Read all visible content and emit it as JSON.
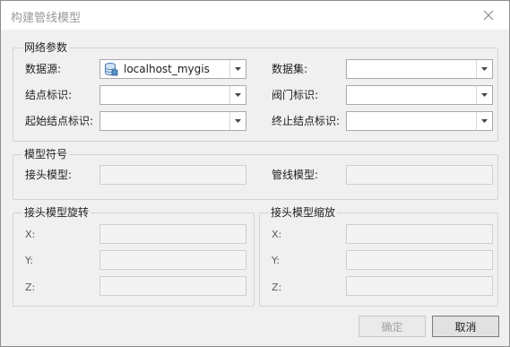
{
  "window": {
    "title": "构建管线模型"
  },
  "network_params": {
    "legend": "网络参数",
    "datasource_label": "数据源:",
    "datasource_value": "localhost_mygis",
    "dataset_label": "数据集:",
    "dataset_value": "",
    "node_id_label": "结点标识:",
    "node_id_value": "",
    "valve_id_label": "阀门标识:",
    "valve_id_value": "",
    "start_node_label": "起始结点标识:",
    "start_node_value": "",
    "end_node_label": "终止结点标识:",
    "end_node_value": ""
  },
  "model_symbol": {
    "legend": "模型符号",
    "joint_model_label": "接头模型:",
    "pipe_model_label": "管线模型:"
  },
  "joint_rotation": {
    "legend": "接头模型旋转",
    "x_label": "X:",
    "y_label": "Y:",
    "z_label": "Z:"
  },
  "joint_scale": {
    "legend": "接头模型缩放",
    "x_label": "X:",
    "y_label": "Y:",
    "z_label": "Z:"
  },
  "buttons": {
    "ok": "确定",
    "cancel": "取消"
  },
  "icons": {
    "close": "close-icon",
    "dropdown": "chevron-down-icon",
    "datasource": "database-icon"
  }
}
